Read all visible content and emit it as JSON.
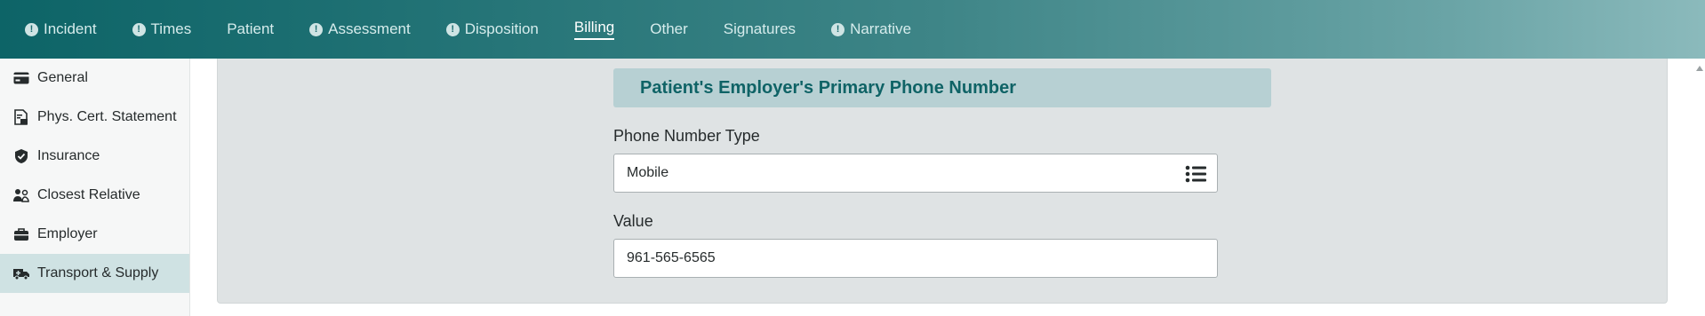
{
  "tabs": [
    {
      "label": "Incident",
      "alert": true,
      "active": false
    },
    {
      "label": "Times",
      "alert": true,
      "active": false
    },
    {
      "label": "Patient",
      "alert": false,
      "active": false
    },
    {
      "label": "Assessment",
      "alert": true,
      "active": false
    },
    {
      "label": "Disposition",
      "alert": true,
      "active": false
    },
    {
      "label": "Billing",
      "alert": false,
      "active": true
    },
    {
      "label": "Other",
      "alert": false,
      "active": false
    },
    {
      "label": "Signatures",
      "alert": false,
      "active": false
    },
    {
      "label": "Narrative",
      "alert": true,
      "active": false
    }
  ],
  "alert_glyph": "!",
  "sidebar": {
    "items": [
      {
        "label": "General",
        "icon": "credit-card-icon",
        "active": false
      },
      {
        "label": "Phys. Cert. Statement",
        "icon": "document-cert-icon",
        "active": false
      },
      {
        "label": "Insurance",
        "icon": "shield-check-icon",
        "active": false
      },
      {
        "label": "Closest Relative",
        "icon": "people-icon",
        "active": false
      },
      {
        "label": "Employer",
        "icon": "briefcase-icon",
        "active": false
      },
      {
        "label": "Transport & Supply",
        "icon": "ambulance-icon",
        "active": true
      }
    ]
  },
  "section": {
    "title": "Patient's Employer's Primary Phone Number"
  },
  "fields": {
    "phone_type_label": "Phone Number Type",
    "phone_type_value": "Mobile",
    "value_label": "Value",
    "value_value": "961-565-6565"
  },
  "colors": {
    "brand": "#0d6467",
    "header_bg": "#b7d0d3",
    "header_text": "#0f6366",
    "active_sidebar": "#cfe2e3"
  }
}
